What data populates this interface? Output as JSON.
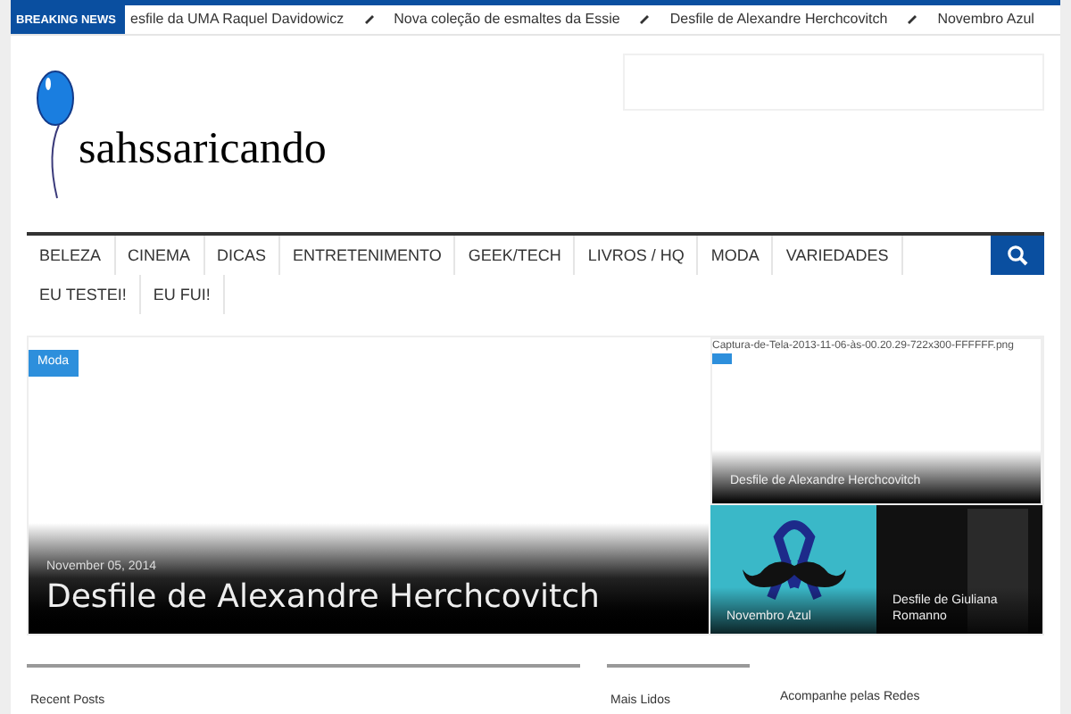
{
  "breaking_news": {
    "label": "BREAKING NEWS",
    "items": [
      "esfile da UMA Raquel Davidowicz",
      "Nova coleção de esmaltes da Essie",
      "Desfile de Alexandre Herchcovitch",
      "Novembro Azul"
    ]
  },
  "site": {
    "name": "sahssaricando"
  },
  "nav": {
    "items": [
      {
        "label": "BELEZA"
      },
      {
        "label": "CINEMA"
      },
      {
        "label": "DICAS"
      },
      {
        "label": "ENTRETENIMENTO"
      },
      {
        "label": "GEEK/TECH"
      },
      {
        "label": "LIVROS / HQ"
      },
      {
        "label": "MODA"
      },
      {
        "label": "VARIEDADES"
      },
      {
        "label": "EU TESTEI!"
      },
      {
        "label": "EU FUI!"
      }
    ]
  },
  "featured": {
    "category": "Moda",
    "date": "November 05, 2014",
    "title": "Desfile de Alexandre Herchcovitch"
  },
  "side_posts": [
    {
      "kind": "broken",
      "file": "Captura-de-Tela-2013-11-06-às-00.20.29-722x300-FFFFFF.png",
      "title": "Desfile de Alexandre Herchcovitch"
    },
    {
      "kind": "ribbon",
      "title": "Novembro Azul"
    },
    {
      "kind": "photo",
      "title": "Desfile de Giuliana Romanno"
    }
  ],
  "widgets": [
    "Recent Posts",
    "Mais Lidos",
    "Acompanhe pelas Redes"
  ]
}
